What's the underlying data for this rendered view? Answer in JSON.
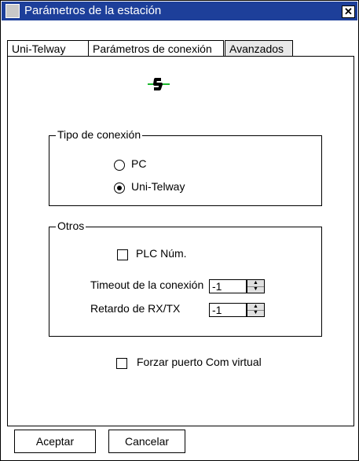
{
  "window": {
    "title": "Parámetros de la estación",
    "close_glyph": "✕"
  },
  "tabs": [
    {
      "label": "Uni-Telway"
    },
    {
      "label": "Parámetros de conexión"
    },
    {
      "label": "Avanzados",
      "active": true
    }
  ],
  "connection_type": {
    "legend": "Tipo de conexión",
    "options": [
      {
        "label": "PC",
        "checked": false
      },
      {
        "label": "Uni-Telway",
        "checked": true
      }
    ]
  },
  "others": {
    "legend": "Otros",
    "plc_num": {
      "label": "PLC Núm.",
      "checked": false
    },
    "timeout": {
      "label": "Timeout de la conexión",
      "value": "-1"
    },
    "rxtx_delay": {
      "label": "Retardo de RX/TX",
      "value": "-1"
    }
  },
  "force_com": {
    "label": "Forzar puerto Com virtual",
    "checked": false
  },
  "buttons": {
    "ok": "Aceptar",
    "cancel": "Cancelar"
  },
  "colors": {
    "titlebar": "#1d3f9a",
    "status_icon": "#1db82e"
  },
  "icons": {
    "status": "connection-status-icon"
  }
}
